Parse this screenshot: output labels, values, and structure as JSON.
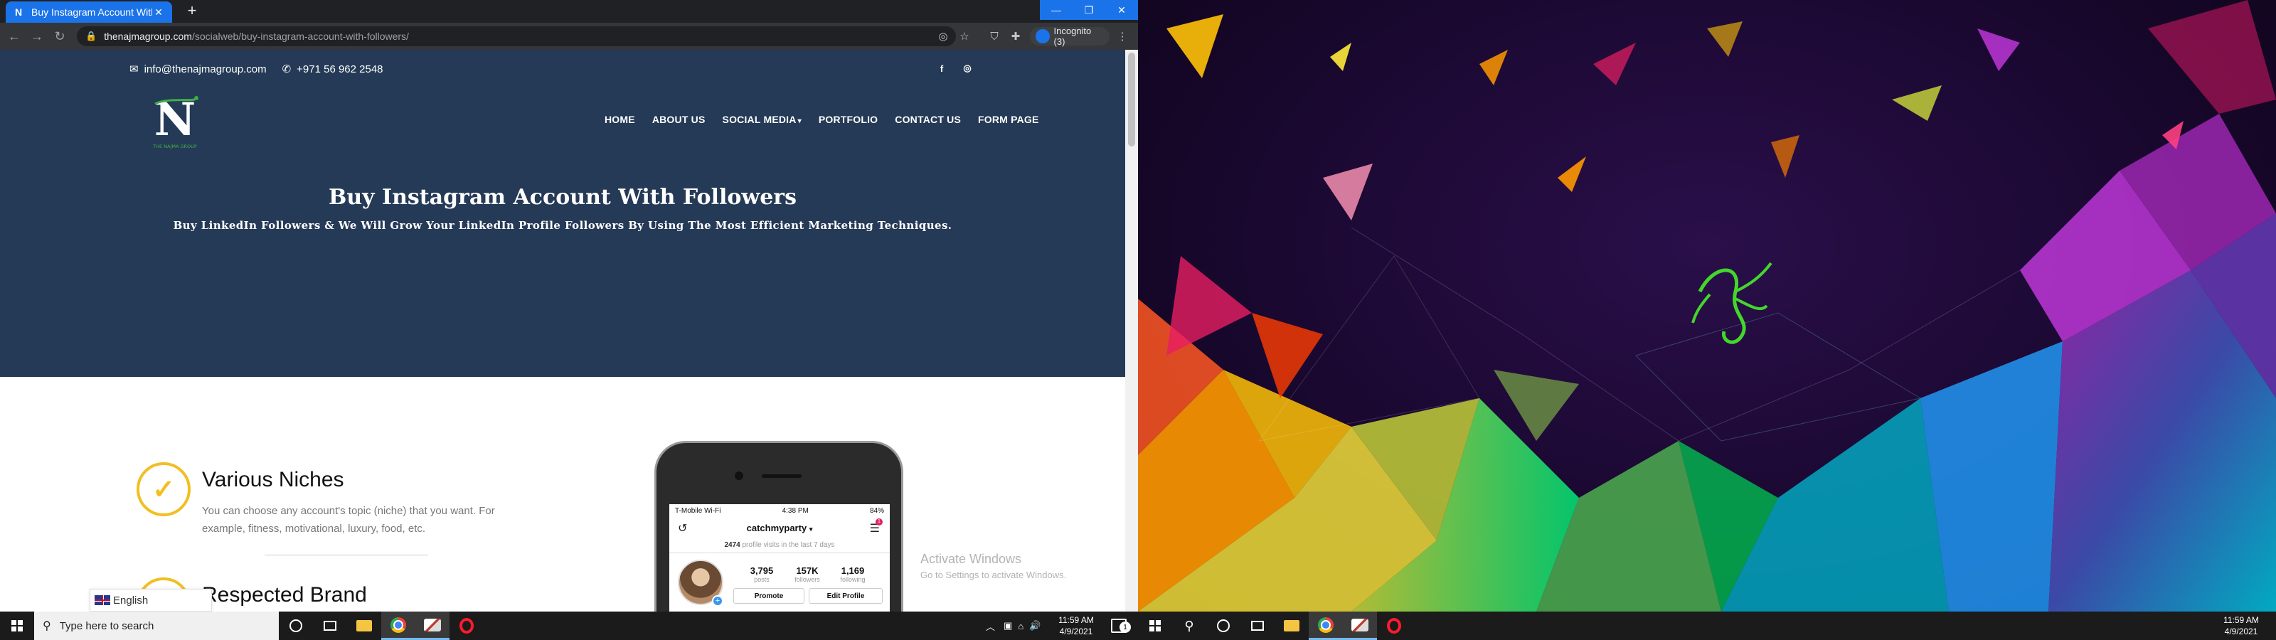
{
  "browser": {
    "tab_title": "Buy Instagram Account With Fol",
    "url_host": "thenajmagroup.com",
    "url_path": "/socialweb/buy-instagram-account-with-followers/",
    "incognito_label": "Incognito (3)"
  },
  "site": {
    "email": "info@thenajmagroup.com",
    "phone": "+971 56 962 2548",
    "logo_letter": "N",
    "logo_text": "THE NAJMA GROUP",
    "nav": [
      "HOME",
      "ABOUT US",
      "SOCIAL MEDIA",
      "PORTFOLIO",
      "CONTACT US",
      "FORM PAGE"
    ],
    "hero_title": "Buy Instagram Account With Followers",
    "hero_subtitle": "Buy LinkedIn Followers & We Will Grow Your LinkedIn Profile Followers By Using The Most Efficient Marketing Techniques.",
    "features": [
      {
        "title": "Various Niches",
        "desc": "You can choose any account's topic (niche) that you want. For example, fitness, motivational, luxury, food, etc."
      },
      {
        "title": "Respected Brand",
        "desc": ""
      }
    ],
    "language": "English"
  },
  "phone_screen": {
    "carrier": "T-Mobile Wi-Fi",
    "time": "4:38 PM",
    "battery": "84%",
    "username": "catchmyparty",
    "visits_count": "2474",
    "visits_text": "profile visits in the last 7 days",
    "badge": "1",
    "stats": [
      {
        "value": "3,795",
        "label": "posts"
      },
      {
        "value": "157K",
        "label": "followers"
      },
      {
        "value": "1,169",
        "label": "following"
      }
    ],
    "promote_label": "Promote",
    "edit_label": "Edit Profile"
  },
  "watermark": {
    "line1": "Activate Windows",
    "line2": "Go to Settings to activate Windows."
  },
  "taskbar": {
    "search_placeholder": "Type here to search",
    "time": "11:59 AM",
    "date": "4/9/2021",
    "notification_count": "1"
  },
  "colors": {
    "hero_bg": "#253a56",
    "accent_yellow": "#f2bf22",
    "chrome_blue": "#1a73e8",
    "razer_green": "#44d62c"
  }
}
